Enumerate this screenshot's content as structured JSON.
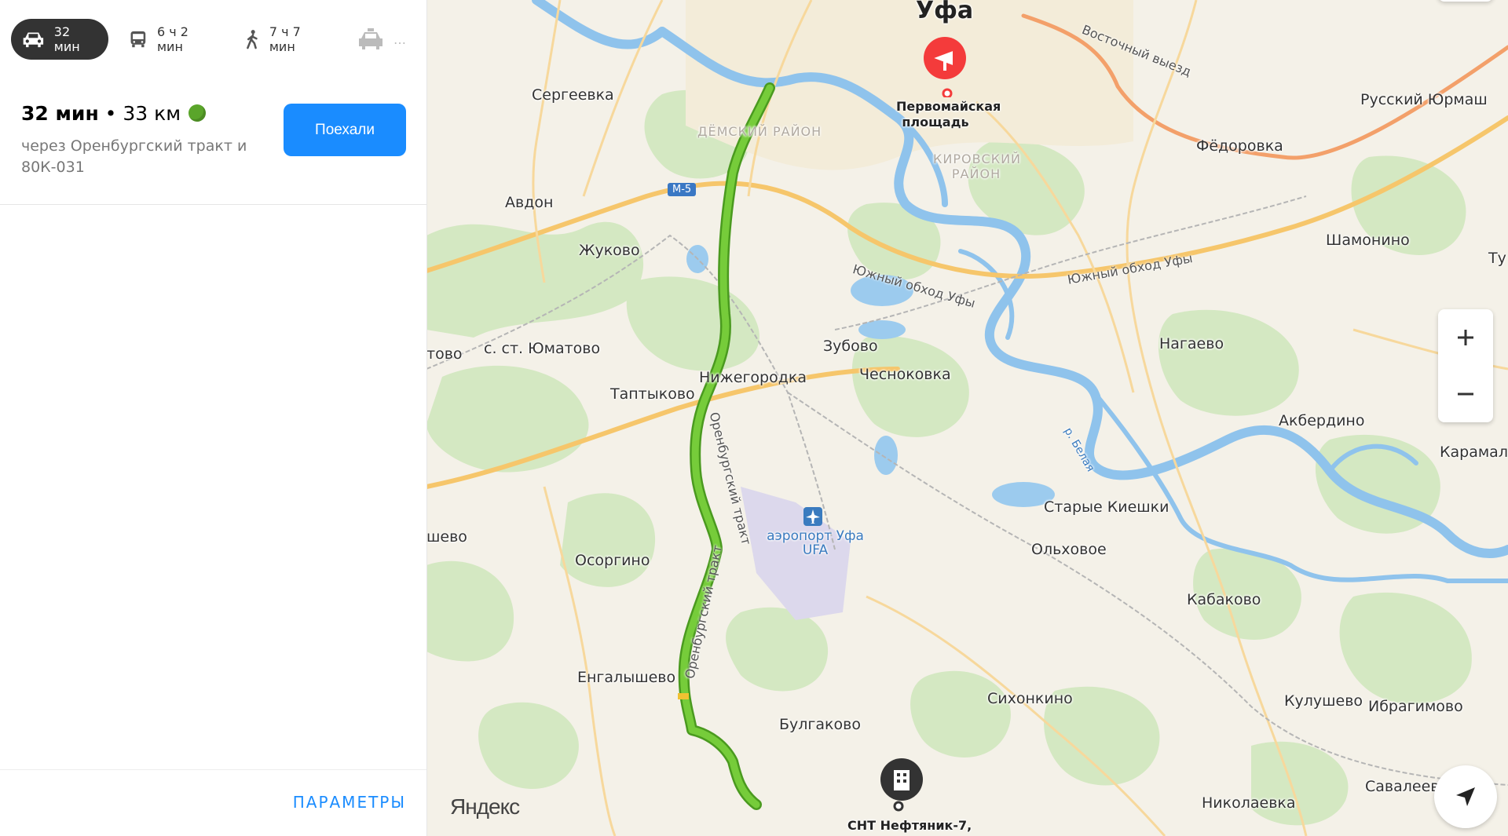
{
  "modes": [
    {
      "icon": "car-icon",
      "label": "32 мин",
      "active": true
    },
    {
      "icon": "bus-icon",
      "label": "6 ч 2 мин",
      "active": false
    },
    {
      "icon": "walk-icon",
      "label": "7 ч 7 мин",
      "active": false
    },
    {
      "icon": "taxi-icon",
      "label": "…",
      "active": false
    }
  ],
  "route": {
    "time": "32 мин",
    "dist_sep": " • ",
    "distance": "33 км",
    "via": "через Оренбургский тракт и 80К-031",
    "traffic_color": "#5aa52a"
  },
  "go_button": "Поехали",
  "params_link": "ПАРАМЕТРЫ",
  "map": {
    "city": "Уфа",
    "logo": "Яндекс",
    "destination": "Первомайская площадь",
    "origin": "СНТ Нефтяник-7,",
    "airport": "аэропорт Уфа UFA",
    "route_color": "#6cc52e",
    "shield": "М-5",
    "zoom_in": "+",
    "zoom_out": "−",
    "places": {
      "sergeevka": "Сергеевка",
      "avdon": "Авдон",
      "zhukovo": "Жуково",
      "yumatovo": "с. ст. Юматово",
      "tovo": "тово",
      "taptykovo": "Таптыково",
      "nizhegorodka": "Нижегородка",
      "zubovo": "Зубово",
      "chesnokovka": "Чесноковка",
      "shevo": "шево",
      "osorgino": "Осоргино",
      "engalyshevo": "Енгалышево",
      "bulgakovo": "Булгаково",
      "sikhonkino": "Сихонкино",
      "olkhovoe": "Ольховое",
      "starye_kieshki": "Старые Киешки",
      "kabakovo": "Кабаково",
      "kulushevo": "Кулушево",
      "ibragimovo": "Ибрагимово",
      "savaleevo": "Савалеево",
      "nikolaevka": "Николаевка",
      "akberdino": "Акбердино",
      "karamaly": "Карамалы",
      "nagaevo": "Нагаево",
      "shamonino": "Шамонино",
      "tu": "Ту",
      "fedorovka": "Фёдоровка",
      "russky_yurmash": "Русский Юрмаш",
      "demsky": "ДЁМСКИЙ РАЙОН",
      "kirovsky": "КИРОВСКИЙ РАЙОН",
      "belaya": "р. Белая"
    },
    "roads": {
      "vostochny": "Восточный выезд",
      "yuzhny1": "Южный обход Уфы",
      "yuzhny2": "Южный обход Уфы",
      "orenb1": "Оренбургский тракт",
      "orenb2": "Оренбургский тракт"
    }
  }
}
